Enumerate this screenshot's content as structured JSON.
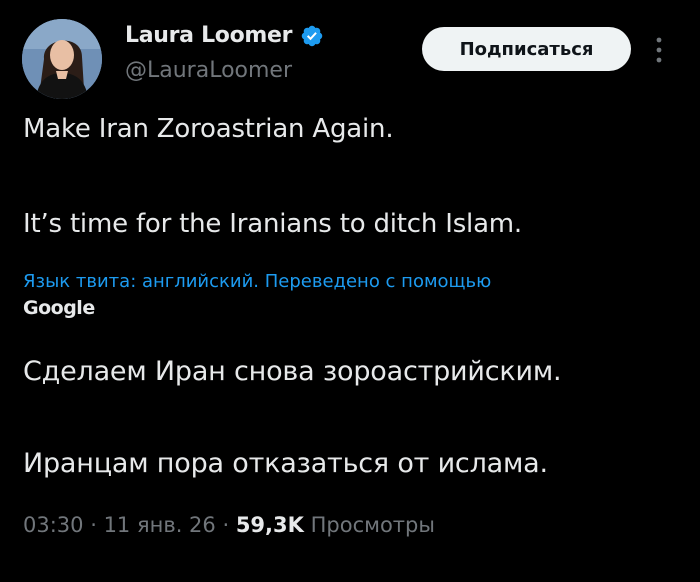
{
  "author": {
    "display_name": "Laura Loomer",
    "handle": "@LauraLoomer",
    "verified": true
  },
  "follow_button_label": "Подписаться",
  "tweet": {
    "lines": [
      "Make Iran Zoroastrian Again.",
      "It’s time for the Iranians to ditch Islam."
    ]
  },
  "translation": {
    "note": "Язык твита: английский. Переведено с помощью",
    "provider": "Google",
    "lines": [
      "Сделаем Иран снова зороастрийским.",
      "Иранцам пора отказаться от ислама."
    ]
  },
  "meta": {
    "time": "03:30",
    "separator": " · ",
    "date": "11 янв. 26",
    "views_count": "59,3K",
    "views_label": "Просмотры"
  },
  "colors": {
    "background": "#000000",
    "text": "#e7e9ea",
    "secondary_text": "#71767b",
    "link": "#1d9bf0",
    "verified_badge": "#1d9bf0",
    "button_background": "#eff3f4"
  },
  "icons": {
    "verified": "verified-badge-icon",
    "more": "more-vertical-icon"
  }
}
